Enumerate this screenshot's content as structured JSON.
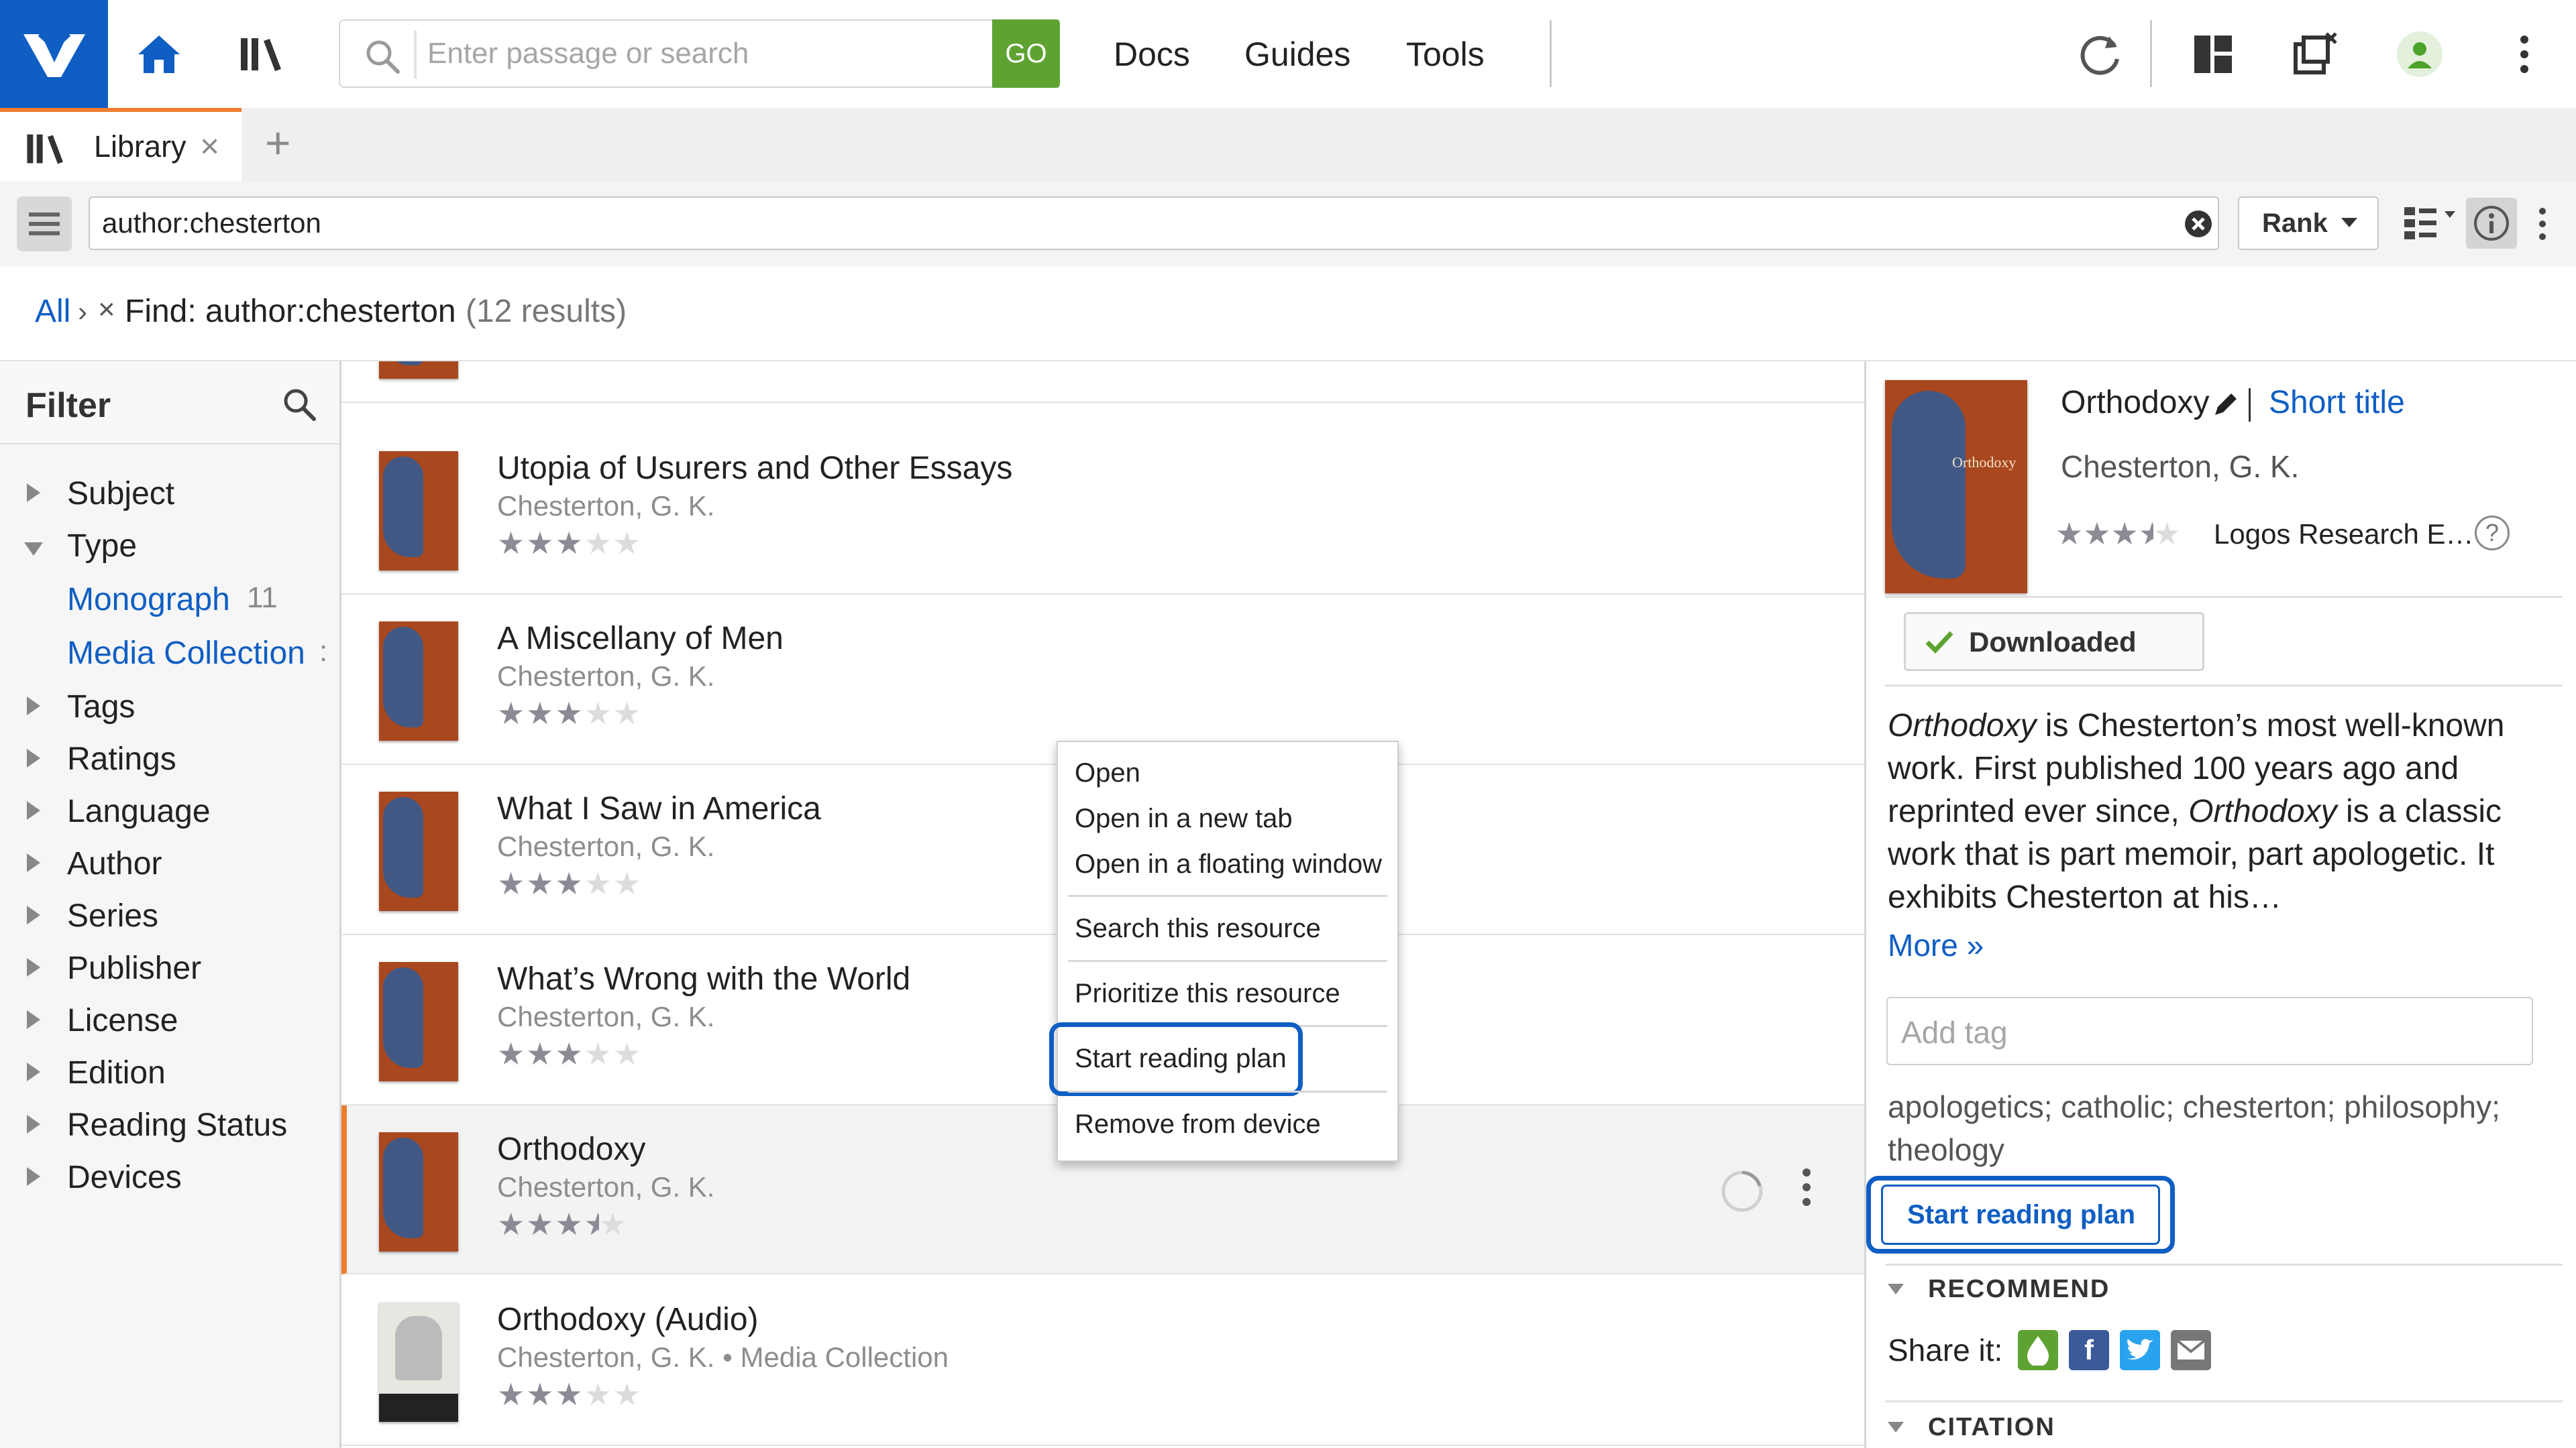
{
  "header": {
    "search_placeholder": "Enter passage or search",
    "go_label": "GO",
    "nav": [
      "Docs",
      "Guides",
      "Tools"
    ],
    "accent_color": "#0f5ec3",
    "go_color": "#5ea332"
  },
  "tabs": {
    "active_label": "Library",
    "close_glyph": "×",
    "add_glyph": "+"
  },
  "toolbar": {
    "query": "author:chesterton",
    "sort_label": "Rank"
  },
  "breadcrumb": {
    "all": "All",
    "separator": "›",
    "remove": "×",
    "find": "Find: author:chesterton",
    "count": "(12 results)"
  },
  "filter": {
    "title": "Filter",
    "groups": [
      "Subject",
      "Type",
      "Tags",
      "Ratings",
      "Language",
      "Author",
      "Series",
      "Publisher",
      "License",
      "Edition",
      "Reading Status",
      "Devices"
    ],
    "type_options": [
      {
        "label": "Monograph",
        "count": "11"
      },
      {
        "label": "Media Collection",
        "count": ":"
      }
    ]
  },
  "results": [
    {
      "title": "Utopia of Usurers and Other Essays",
      "author": "Chesterton, G. K.",
      "rating": 3
    },
    {
      "title": "A Miscellany of Men",
      "author": "Chesterton, G. K.",
      "rating": 3
    },
    {
      "title": "What I Saw in America",
      "author": "Chesterton, G. K.",
      "rating": 3
    },
    {
      "title": "What’s Wrong with the World",
      "author": "Chesterton, G. K.",
      "rating": 3
    },
    {
      "title": "Orthodoxy",
      "author": "Chesterton, G. K.",
      "rating": 3.5,
      "selected": true
    },
    {
      "title": "Orthodoxy (Audio)",
      "author": "Chesterton, G. K. • Media Collection",
      "rating": 3
    }
  ],
  "context_menu": {
    "items": [
      "Open",
      "Open in a new tab",
      "Open in a floating window",
      "Search this resource",
      "Prioritize this resource",
      "Start reading plan",
      "Remove from device"
    ],
    "highlighted": "Start reading plan"
  },
  "info_panel": {
    "title": "Orthodoxy",
    "short_title_link": "Short title",
    "author": "Chesterton, G. K.",
    "publisher": "Logos Research E…",
    "rating": 3.5,
    "downloaded_label": "Downloaded",
    "description_italic_1": "Orthodoxy",
    "description_part_1": " is Chesterton’s most well-known work. First published 100 years ago and reprinted ever since, ",
    "description_italic_2": "Orthodoxy",
    "description_part_2": " is a classic work that is part memoir, part apologetic. It exhibits Chesterton at his…",
    "more_link": "More »",
    "tag_placeholder": "Add tag",
    "tags": "apologetics; catholic; chesterton; philosophy; theology",
    "start_reading_plan": "Start reading plan",
    "recommend_heading": "RECOMMEND",
    "share_label": "Share it:",
    "citation_heading": "CITATION"
  }
}
